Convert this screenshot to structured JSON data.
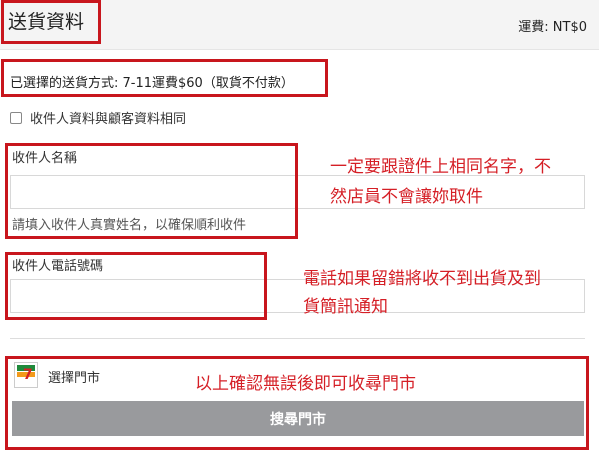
{
  "header": {
    "title": "送貨資料",
    "shipping_fee": "運費: NT$0"
  },
  "delivery_method": "已選擇的送貨方式: 7-11運費$60（取貨不付款）",
  "same_as_customer": {
    "label": "收件人資料與顧客資料相同",
    "checked": false
  },
  "recipient_name": {
    "label": "收件人名稱",
    "value": "",
    "hint": "請填入收件人真實姓名，以確保順利收件"
  },
  "recipient_phone": {
    "label": "收件人電話號碼",
    "value": ""
  },
  "store": {
    "label": "選擇門市",
    "search_button": "搜尋門市",
    "logo_text": "7"
  },
  "annotations": {
    "name_note_line1": "一定要跟證件上相同名字，不",
    "name_note_line2": "然店員不會讓妳取件",
    "phone_note_line1": "電話如果留錯將收不到出貨及到",
    "phone_note_line2": "貨簡訊通知",
    "store_note": "以上確認無誤後即可收尋門市"
  },
  "colors": {
    "annotation_red": "#c8161d",
    "button_gray": "#999a9d",
    "header_bg": "#f4f4f4"
  }
}
